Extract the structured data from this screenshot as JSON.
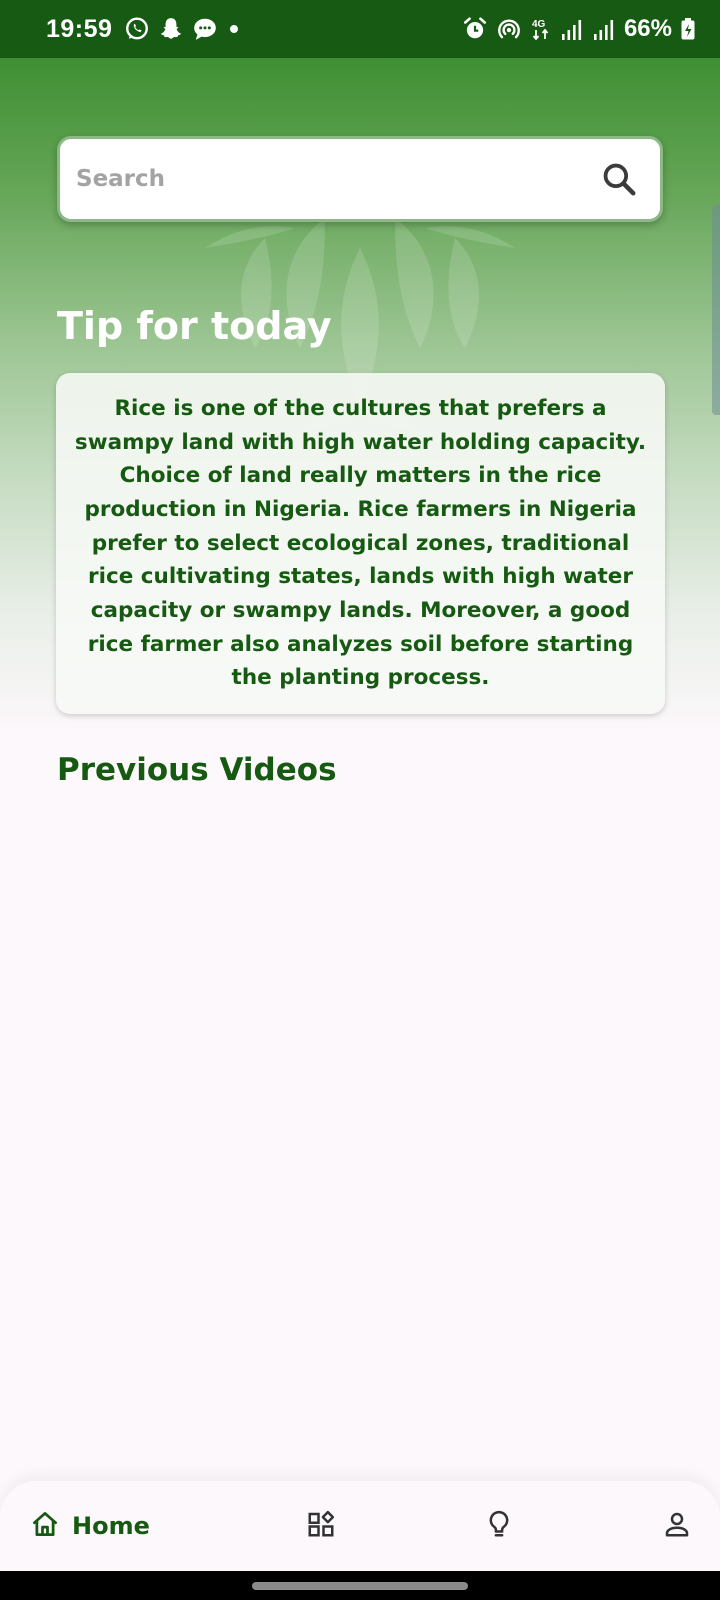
{
  "status_bar": {
    "time": "19:59",
    "battery": "66%",
    "left_icons": [
      "whatsapp-icon",
      "snapchat-icon",
      "message-icon",
      "dot-icon"
    ],
    "right_icons": [
      "alarm-icon",
      "hotspot-icon",
      "4g-icon",
      "signal-icon",
      "signal-icon",
      "battery-charging-icon"
    ]
  },
  "search": {
    "placeholder": "Search",
    "value": ""
  },
  "tip": {
    "title": "Tip for today",
    "text": "Rice is one of the cultures that prefers a swampy land with high water holding capacity. Choice of land really matters in the rice production in Nigeria. Rice farmers in Nigeria prefer to select ecological zones, traditional rice cultivating states, lands with high water capacity or swampy lands. Moreover, a good rice farmer also analyzes soil before starting the planting process."
  },
  "previous_videos": {
    "title": "Previous Videos"
  },
  "bottom_nav": {
    "home_label": "Home",
    "items": [
      "home-icon",
      "categories-icon",
      "lightbulb-icon",
      "profile-icon"
    ]
  },
  "colors": {
    "primary_green": "#165a12",
    "status_bar": "#175a13",
    "background": "#fdf8fc"
  }
}
